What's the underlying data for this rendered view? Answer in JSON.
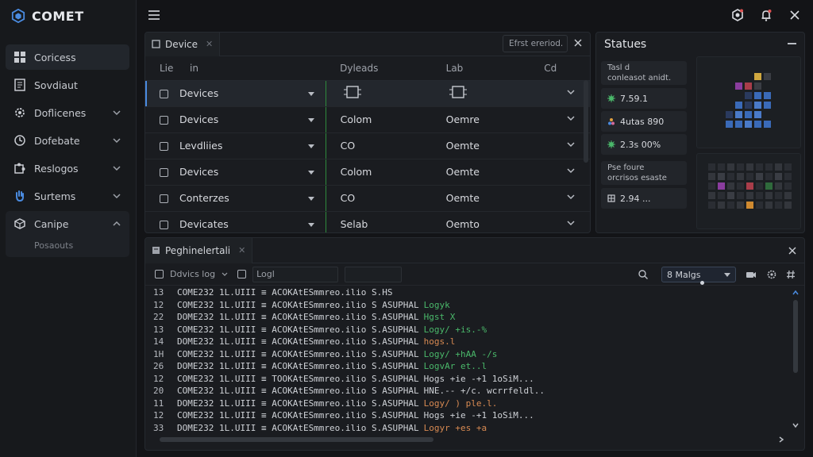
{
  "app": {
    "name": "COMET"
  },
  "colors": {
    "accent": "#4a8be0",
    "green": "#4ab86a",
    "orange": "#d88a52",
    "pink": "#d46a9c",
    "bg": "#131417"
  },
  "sidebar": {
    "items": [
      {
        "label": "Coricess",
        "icon": "grid-icon"
      },
      {
        "label": "Sovdiaut",
        "icon": "document-icon"
      },
      {
        "label": "Doflicenes",
        "icon": "gear-icon"
      },
      {
        "label": "Dofebate",
        "icon": "clock-icon"
      },
      {
        "label": "Reslogos",
        "icon": "puzzle-icon"
      },
      {
        "label": "Surtems",
        "icon": "hand-icon"
      },
      {
        "label": "Canipe",
        "icon": "cube-icon"
      }
    ],
    "sub_item": "Posaouts"
  },
  "devices_panel": {
    "tab_label": "Device",
    "filter_text": "Efrst ereriod.",
    "columns": [
      "Lie",
      "in",
      "Dyleads",
      "Lab",
      "Cd"
    ],
    "rows": [
      {
        "name": "Devices",
        "dyleads": "",
        "lab": ""
      },
      {
        "name": "Devices",
        "dyleads": "Colom",
        "lab": "Oemre"
      },
      {
        "name": "Levdliies",
        "dyleads": "CO",
        "lab": "Oemte"
      },
      {
        "name": "Devices",
        "dyleads": "Colom",
        "lab": "Oemte"
      },
      {
        "name": "Conterzes",
        "dyleads": "CO",
        "lab": "Oemte"
      },
      {
        "name": "Devicates",
        "dyleads": "Selab",
        "lab": "Oemto"
      }
    ]
  },
  "statues_panel": {
    "title": "Statues",
    "card1_line1": "Tasl d",
    "card1_line2": "conleasot anidt.",
    "metric1": "7.59.1",
    "metric2": "4utas 890",
    "metric3": "2.3s 00%",
    "card2_line1": "Pse foure",
    "card2_line2": "orcrisos esaste",
    "metric4": "2.94 ..."
  },
  "log_panel": {
    "tab_label": "Peghinelertali",
    "filter_label": "Ddvics log",
    "field_label": "Logl",
    "select_value": "8 Malgs",
    "lines": [
      {
        "n": "13",
        "text": "COME232 1L.UIII ≡ ACOKAtESmmreo.ilio S.HS",
        "msg": "",
        "cls": "b"
      },
      {
        "n": "12",
        "text": "COME232 1L.UIII ≡ ACOKAtESmmreo.ilio S ASUPHAL",
        "msg": "Logyk",
        "cls": ""
      },
      {
        "n": "22",
        "text": "DOME232 1L.UIII ≡ ACOKAtESmmreo.ilio S.ASUPHAL",
        "msg": "Hgst X",
        "cls": ""
      },
      {
        "n": "13",
        "text": "COME232 1L.UIII ≡ ACOKAtESmmreo.ilio S.ASUPHAL",
        "msg": "Logy/ +is.-%",
        "cls": ""
      },
      {
        "n": "14",
        "text": "DOME232 1L.UIII ≡ ACOKAtESmmreo.ilio S.ASUPHAL",
        "msg": "hogs.l",
        "cls": "o"
      },
      {
        "n": "1H",
        "text": "COME232 1L.UIII ≡ ACOKAtESmmreo.ilio S.ASUPHAL",
        "msg": "Logy/ +hAA -/s",
        "cls": ""
      },
      {
        "n": "26",
        "text": "DOME232 1L.UIII ≡ ACOKAtESmmreo.ilio S.ASUPHAL",
        "msg": "LogvAr et..l",
        "cls": ""
      },
      {
        "n": "12",
        "text": "COME232 1L.UIII ≡ TOOKAtESmmreo.ilio S.ASUPHAL",
        "msg": "Hogs +ie -+1 1oSiM...",
        "cls": "w"
      },
      {
        "n": "20",
        "text": "COME232 1L.UIII ≡ ACOKAtESmmreo.ilio S ASUPHAL",
        "msg": "HNE.-- +/c. wcrrfeldl..",
        "cls": "w"
      },
      {
        "n": "11",
        "text": "DOME232 1L.UIII ≡ ACOKAtESmmreo.ilio S.ASUPHAL",
        "msg": "Logy/ ) ple.l.",
        "cls": ""
      },
      {
        "n": "12",
        "text": "COME232 1L.UIII ≡ ACOKAtESmmreo.ilio S.ASUPHAL",
        "msg": "Hogs +ie -+1 1oSiM...",
        "cls": "w"
      },
      {
        "n": "33",
        "text": "DOME232 1L.UIII ≡ ACOKAtESmmreo.ilio S.ASUPHAL",
        "msg": "Logyr +es +a",
        "cls": "o"
      }
    ]
  }
}
